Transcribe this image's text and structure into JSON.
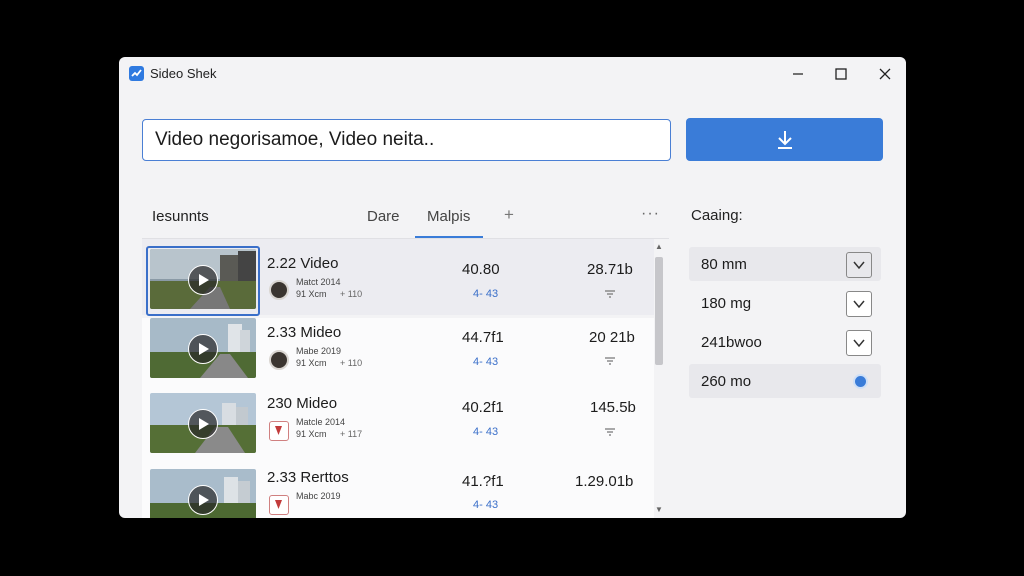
{
  "window": {
    "title": "Sideo Shek"
  },
  "search": {
    "value": "Video negorisamoe, Video neita.."
  },
  "download": {
    "icon": "download-icon"
  },
  "list_header": {
    "title": "Iesunnts",
    "tabs": [
      "Dare",
      "Malpis"
    ],
    "add_label": "+",
    "more_label": "···"
  },
  "rows": [
    {
      "title": "2.22 Video",
      "meta1": "Matct 2014",
      "meta2": "91 Xcm",
      "meta3": "+ 110",
      "col_a": "40.80",
      "col_a2": "4- 43",
      "col_b": "28.71b",
      "selected": true
    },
    {
      "title": "2.33 Mideo",
      "meta1": "Mabe 2019",
      "meta2": "91 Xcm",
      "meta3": "+ 110",
      "col_a": "44.7f1",
      "col_a2": "4- 43",
      "col_b": "20 21b"
    },
    {
      "title": "230 Mideo",
      "meta1": "Matcle 2014",
      "meta2": "91 Xcm",
      "meta3": "+ 117",
      "col_a": "40.2f1",
      "col_a2": "4- 43",
      "col_b": "145.5b"
    },
    {
      "title": "2.33 Rerttos",
      "meta1": "Mabc 2019",
      "meta2": "",
      "meta3": "",
      "col_a": "41.?f1",
      "col_a2": "4- 43",
      "col_b": "1.29.01b"
    }
  ],
  "caching": {
    "title": "Caaing:",
    "options": [
      {
        "label": "80 mm",
        "control": "checkbox-checked",
        "highlighted": true
      },
      {
        "label": "180 mg",
        "control": "checkbox-checked"
      },
      {
        "label": "241bwoo",
        "control": "checkbox-checked"
      },
      {
        "label": "260 mo",
        "control": "radio-selected",
        "highlighted": true
      }
    ]
  },
  "colors": {
    "accent": "#3a7cd8",
    "window_bg": "#f3f3f5",
    "outer_bg": "#000000"
  }
}
